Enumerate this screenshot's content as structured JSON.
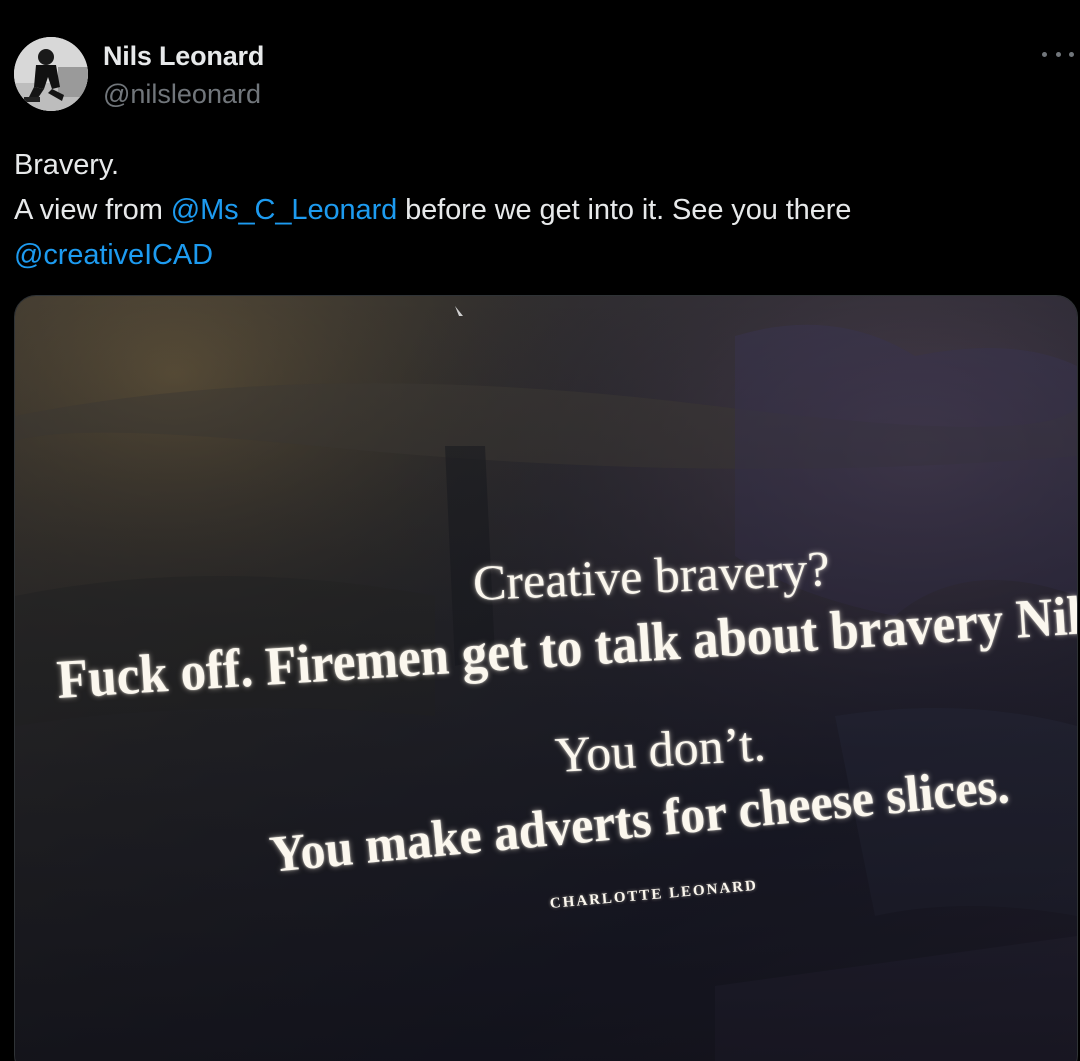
{
  "author": {
    "name": "Nils Leonard",
    "handle": "@nilsleonard",
    "avatar_icon": "profile-photo"
  },
  "menu": {
    "icon": "more-options-icon"
  },
  "tweet": {
    "line1": "Bravery.",
    "line2_prefix": "A view from ",
    "mention1": "@Ms_C_Leonard",
    "line2_suffix": " before we get into it. See you there",
    "mention2": "@creativeICAD"
  },
  "media": {
    "quote_line1": "Creative bravery?",
    "quote_line2": "Fuck off. Firemen get to talk about bravery Nils.",
    "quote_line3": "You don’t.",
    "quote_line4": "You make adverts for cheese slices.",
    "attribution": "CHARLOTTE LEONARD"
  },
  "colors": {
    "background": "#000000",
    "text": "#e7e9ea",
    "secondary": "#71767b",
    "link": "#1d9bf0"
  }
}
